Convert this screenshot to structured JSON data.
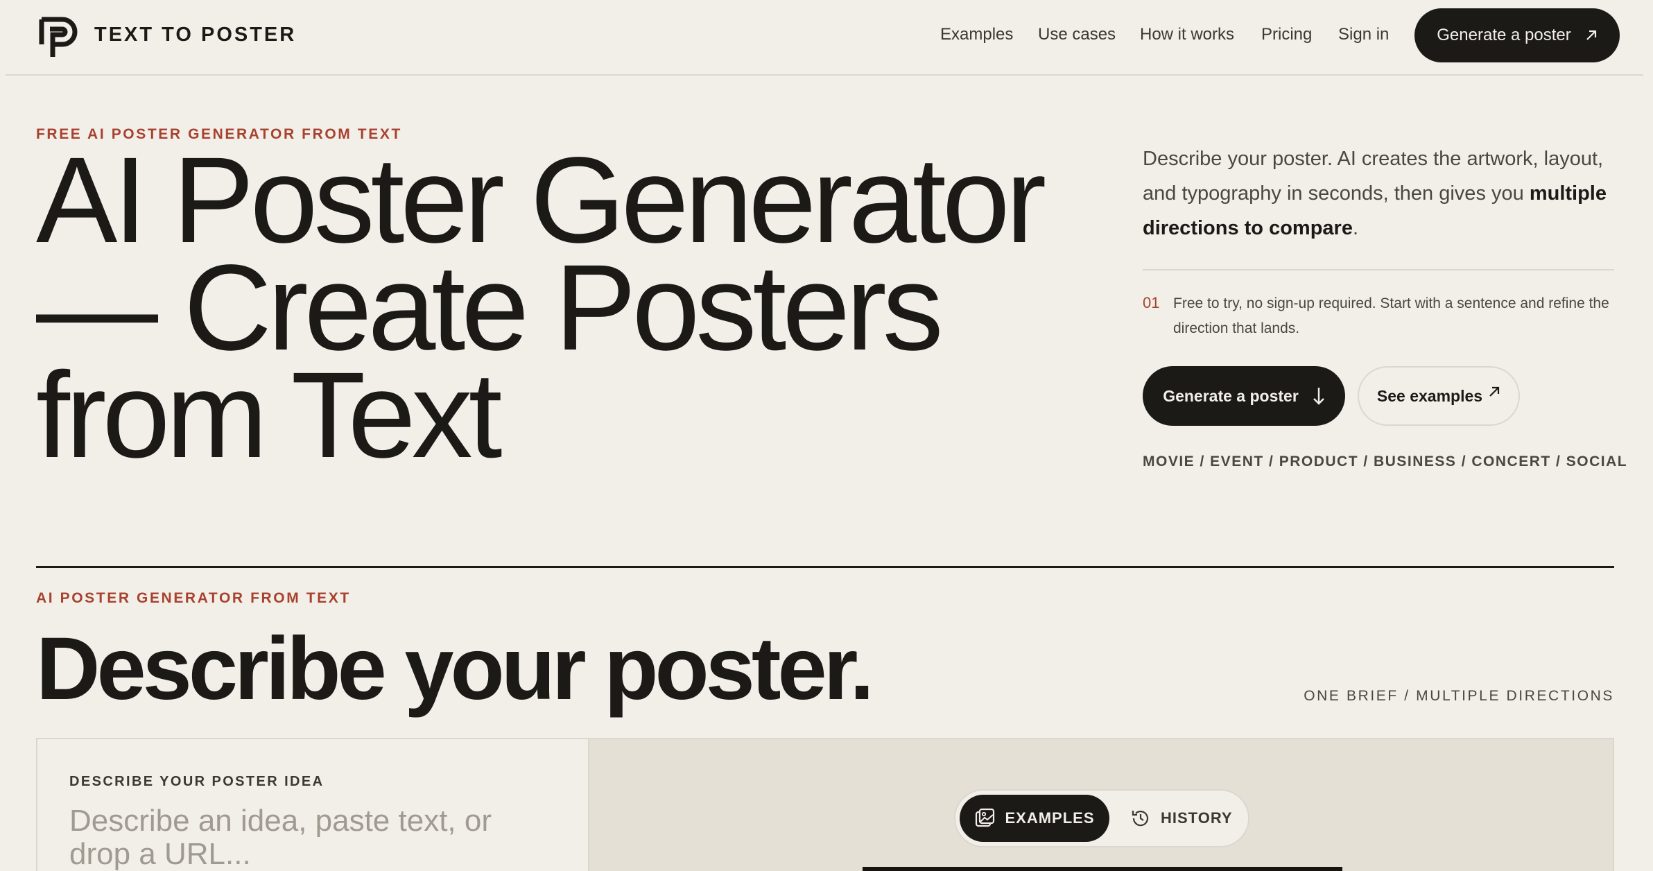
{
  "header": {
    "brand": "TEXT TO POSTER",
    "nav": [
      "Examples",
      "Use cases",
      "How it works",
      "Pricing",
      "Sign in"
    ],
    "cta_label": "Generate a poster"
  },
  "hero": {
    "eyebrow": "FREE AI POSTER GENERATOR FROM TEXT",
    "title_lines": [
      "AI Poster Generator",
      "— Create Posters",
      "from Text"
    ],
    "intro_prefix": "Describe your poster. AI creates the artwork, layout, and typography in seconds, then gives you ",
    "intro_emphasis": "multiple directions to compare",
    "intro_suffix": ".",
    "note_number": "01",
    "note_text": "Free to try, no sign-up required. Start with a sentence and refine the direction that lands.",
    "primary_cta": "Generate a poster",
    "secondary_cta": "See examples",
    "tags": "MOVIE / EVENT / PRODUCT / BUSINESS / CONCERT / SOCIAL"
  },
  "generator": {
    "eyebrow": "AI POSTER GENERATOR FROM TEXT",
    "title": "Describe your poster.",
    "meta": "ONE BRIEF / MULTIPLE DIRECTIONS",
    "field_label": "DESCRIBE YOUR POSTER IDEA",
    "input_value": "",
    "input_placeholder": "Describe an idea, paste text, or drop a URL...",
    "tabs": {
      "examples": "EXAMPLES",
      "history": "HISTORY"
    },
    "active_tab": "examples"
  },
  "icons": {
    "logo": "p-logo-icon",
    "nav_cta": "arrow-up-right-icon",
    "primary_cta": "arrow-down-icon",
    "secondary_cta": "arrow-up-right-icon",
    "examples_tab": "images-icon",
    "history_tab": "history-clock-icon"
  },
  "colors": {
    "background": "#f2efe9",
    "ink": "#1b1a17",
    "accent": "#a8412e",
    "panel": "#e5e0d6"
  }
}
